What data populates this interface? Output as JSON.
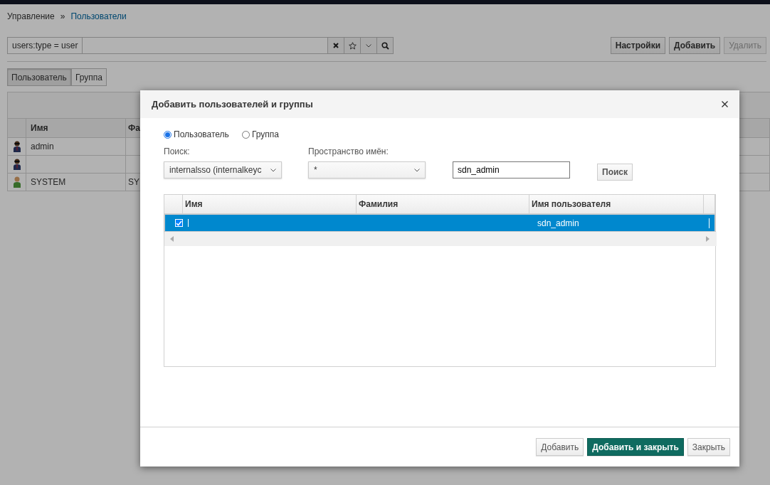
{
  "breadcrumb": [
    {
      "label": "Управление",
      "link": false
    },
    {
      "label": "»",
      "link": false
    },
    {
      "label": "Пользователи",
      "link": true
    }
  ],
  "filter": {
    "query": "users:type = user"
  },
  "toolbar_buttons": [
    {
      "label": "Настройки",
      "disabled": false
    },
    {
      "label": "Добавить",
      "disabled": false
    },
    {
      "label": "Удалить",
      "disabled": true
    }
  ],
  "type_tabs": [
    {
      "label": "Пользователь",
      "selected": true
    },
    {
      "label": "Группа",
      "selected": false
    }
  ],
  "users_table": {
    "columns": [
      "Имя",
      "Фа"
    ],
    "rows": [
      {
        "kind": "admin",
        "cells": [
          "admin",
          ""
        ]
      },
      {
        "kind": "admin",
        "cells": [
          "",
          ""
        ]
      },
      {
        "kind": "user",
        "cells": [
          "SYSTEM",
          "SY"
        ]
      }
    ]
  },
  "dialog": {
    "title": "Добавить пользователей и группы",
    "radios": [
      {
        "label": "Пользователь",
        "selected": true
      },
      {
        "label": "Группа",
        "selected": false
      }
    ],
    "search_label": "Поиск:",
    "search_select": "internalsso (internalkeyc",
    "namespace_label": "Пространство имён:",
    "namespace_select": "*",
    "query": "sdn_admin",
    "search_button": "Поиск",
    "results": {
      "columns": [
        "Имя",
        "Фамилия",
        "Имя пользователя"
      ],
      "rows": [
        {
          "selected": true,
          "checked": true,
          "cells": [
            "",
            "",
            "sdn_admin"
          ]
        }
      ]
    },
    "buttons": [
      {
        "label": "Добавить",
        "primary": false
      },
      {
        "label": "Добавить и закрыть",
        "primary": true
      },
      {
        "label": "Закрыть",
        "primary": false
      }
    ]
  }
}
